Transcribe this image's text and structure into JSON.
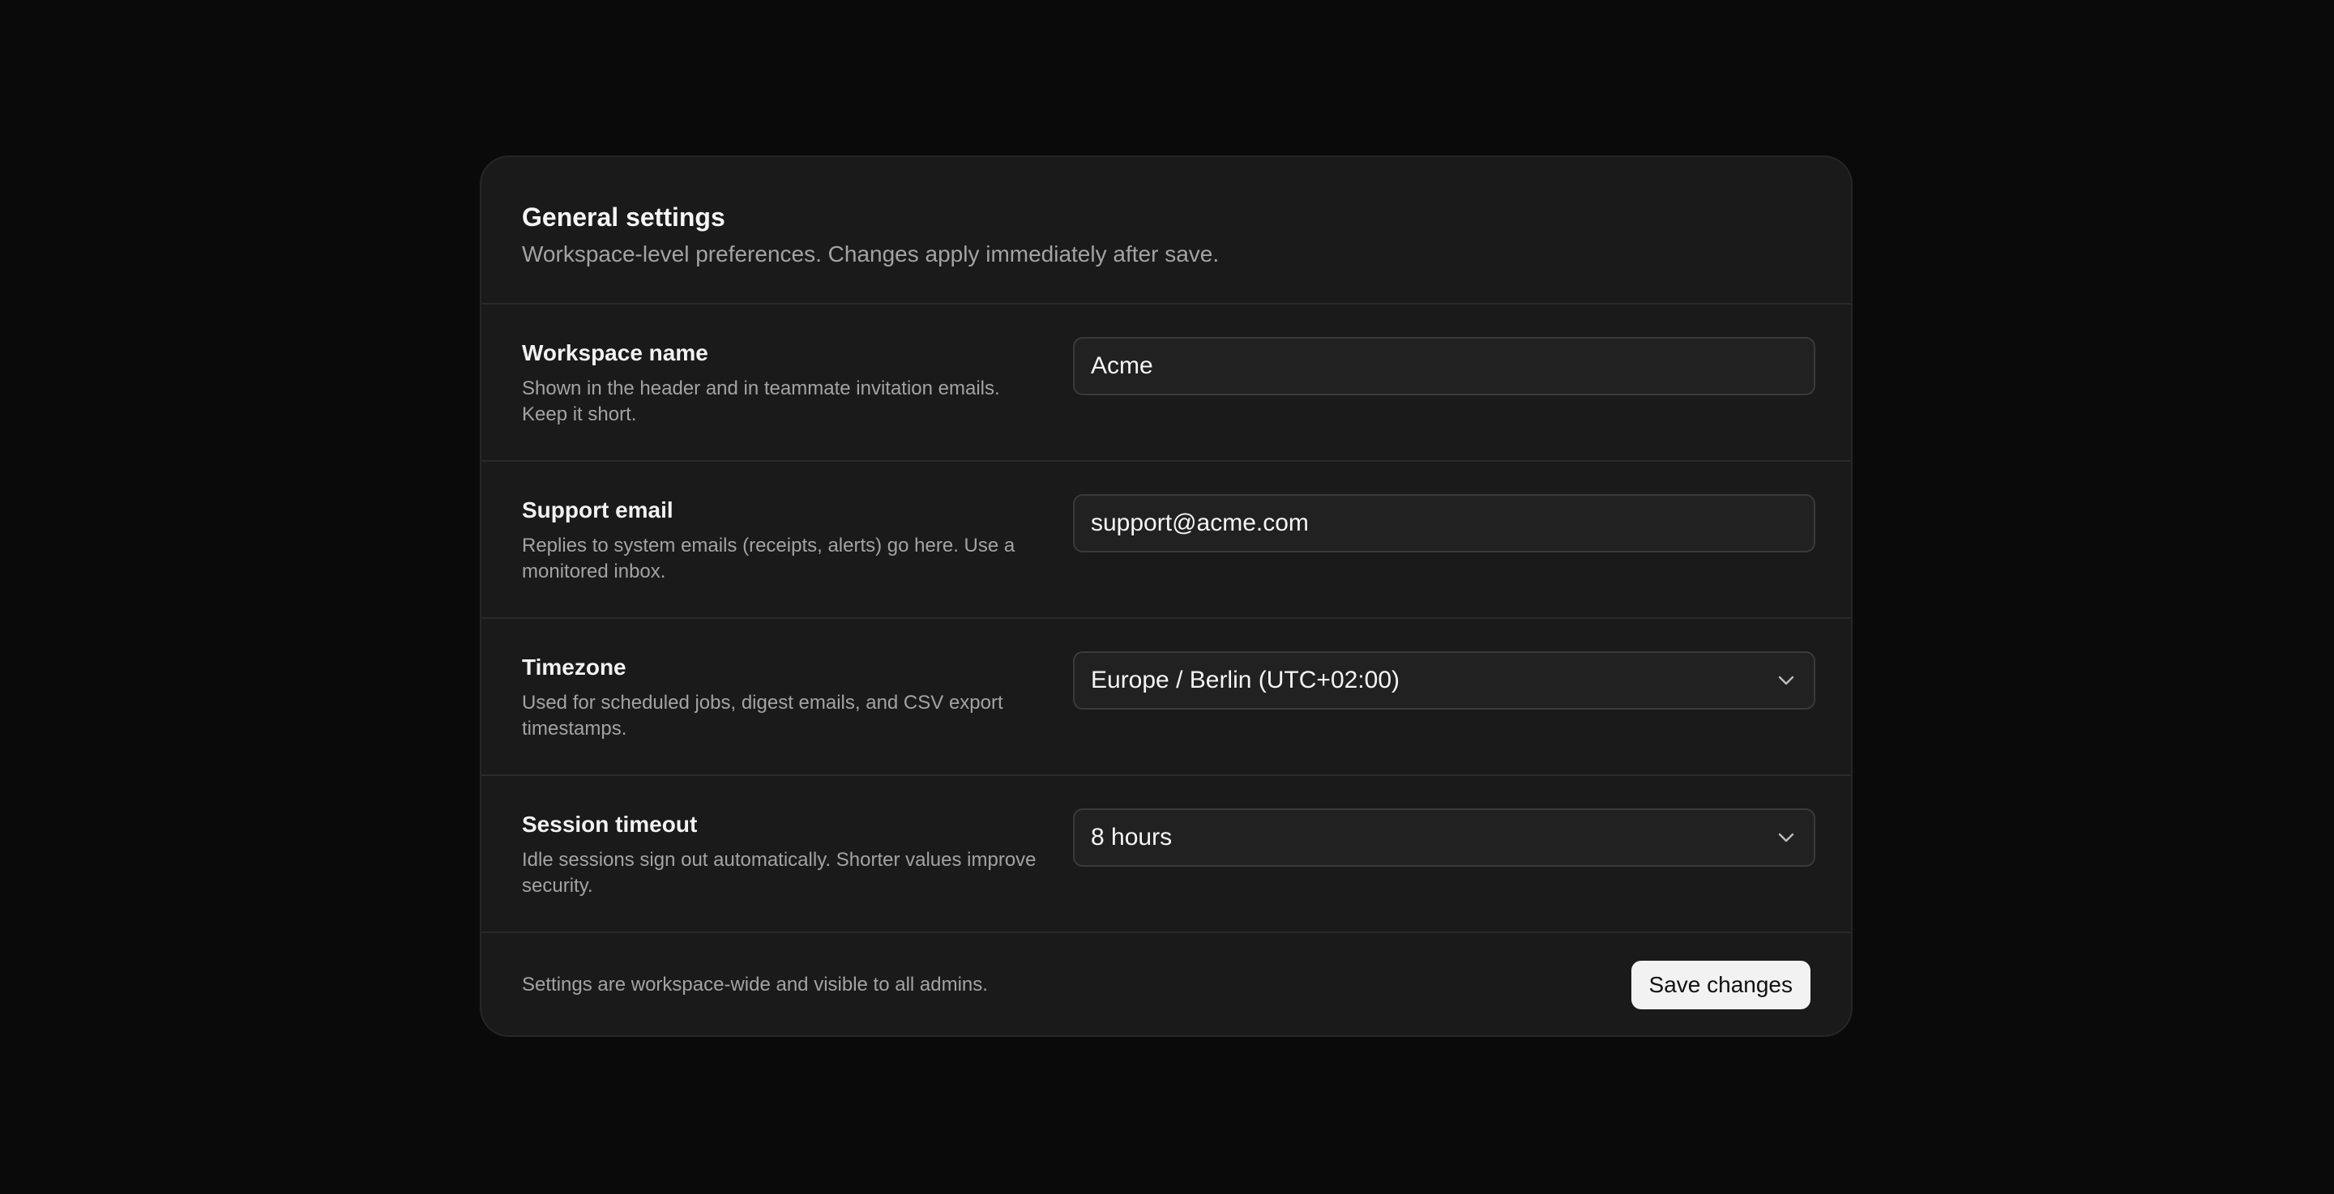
{
  "header": {
    "title": "General settings",
    "subtitle": "Workspace-level preferences. Changes apply immediately after save."
  },
  "fields": {
    "workspace_name": {
      "label": "Workspace name",
      "help": "Shown in the header and in teammate invitation emails. Keep it short.",
      "value": "Acme"
    },
    "support_email": {
      "label": "Support email",
      "help": "Replies to system emails (receipts, alerts) go here. Use a monitored inbox.",
      "value": "support@acme.com"
    },
    "timezone": {
      "label": "Timezone",
      "help": "Used for scheduled jobs, digest emails, and CSV export timestamps.",
      "value": "Europe / Berlin (UTC+02:00)"
    },
    "session_timeout": {
      "label": "Session timeout",
      "help": "Idle sessions sign out automatically. Shorter values improve security.",
      "value": "8 hours"
    }
  },
  "footer": {
    "note": "Settings are workspace-wide and visible to all admins.",
    "save_label": "Save changes"
  },
  "colors": {
    "background": "#0a0a0a",
    "card": "#1a1a1a",
    "input": "#212121",
    "button": "#f2f2f2"
  },
  "icons": {
    "select_indicator": "chevron-down-icon"
  }
}
